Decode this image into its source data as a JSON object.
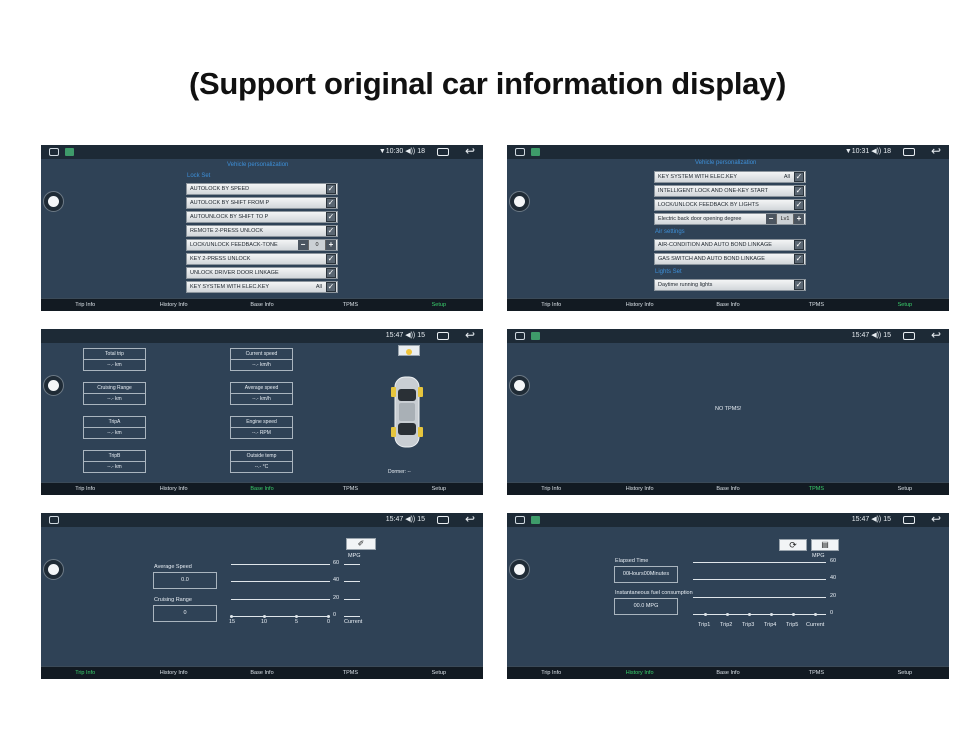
{
  "heading": "(Support original car information display)",
  "nav": [
    "Trip Info",
    "History Info",
    "Base Info",
    "TPMS",
    "Setup"
  ],
  "colors": {
    "panel_bg": "#2f4256",
    "status_bar": "#1d2a36",
    "nav_bg": "#121a22",
    "nav_active": "#3ad16d",
    "section_blue": "#3d8fd8"
  },
  "panels": {
    "p1": {
      "status": "▼10:30 ◀)) 18",
      "title": "Vehicle personalization",
      "section": "Lock Set",
      "rows": [
        {
          "label": "AUTOLOCK BY SPEED",
          "control": "check"
        },
        {
          "label": "AUTOLOCK BY SHIFT FROM P",
          "control": "check"
        },
        {
          "label": "AUTOUNLOCK BY SHIFT TO P",
          "control": "check"
        },
        {
          "label": "REMOTE 2-PRESS UNLOCK",
          "control": "check"
        },
        {
          "label": "LOCK/UNLOCK FEEDBACK-TONE",
          "control": "stepper",
          "value": "0"
        },
        {
          "label": "KEY 2-PRESS UNLOCK",
          "control": "check"
        },
        {
          "label": "UNLOCK DRIVER DOOR LINKAGE",
          "control": "check"
        },
        {
          "label": "KEY SYSTEM WITH ELEC.KEY",
          "control": "check",
          "value": "All"
        }
      ],
      "active_tab": "Setup"
    },
    "p2": {
      "status": "▼10:31 ◀)) 18",
      "title": "Vehicle personalization",
      "rows1": [
        {
          "label": "KEY SYSTEM WITH ELEC.KEY",
          "value": "All"
        },
        {
          "label": "INTELLIGENT LOCK AND ONE-KEY START"
        },
        {
          "label": "LOCK/UNLOCK FEEDBACK BY LIGHTS"
        },
        {
          "label": "Electric back door opening degree",
          "stepper": "Lv1"
        }
      ],
      "section_air": "Air settings",
      "rows2": [
        {
          "label": "AIR-CONDITION AND AUTO BOND LINKAGE"
        },
        {
          "label": "GAS SWITCH AND AUTO BOND LINKAGE"
        }
      ],
      "section_lights": "Lights Set",
      "rows3": [
        {
          "label": "Daytime running lights"
        }
      ],
      "active_tab": "Setup"
    },
    "p3": {
      "status": "15:47 ◀)) 15",
      "left": [
        {
          "label": "Total trip",
          "value": "--.- km"
        },
        {
          "label": "Cruising Range",
          "value": "--.- km"
        },
        {
          "label": "TripA",
          "value": "--.- km"
        },
        {
          "label": "TripB",
          "value": "--.- km"
        }
      ],
      "right": [
        {
          "label": "Current speed",
          "value": "--.- km/h"
        },
        {
          "label": "Average speed",
          "value": "--.- km/h"
        },
        {
          "label": "Engine speed",
          "value": "--.- RPM"
        },
        {
          "label": "Outside temp",
          "value": "--.- °C"
        }
      ],
      "dormer": "Dormer: --",
      "active_tab": "Base Info"
    },
    "p4": {
      "status": "15:47 ◀)) 15",
      "message": "NO TPMS!",
      "active_tab": "TPMS"
    },
    "p5": {
      "status": "15:47 ◀)) 15",
      "avg_speed_label": "Average Speed",
      "avg_speed_value": "0.0",
      "cruising_label": "Cruising Range",
      "cruising_value": "0",
      "unit": "MPG",
      "y_ticks": [
        "60",
        "40",
        "20",
        "0"
      ],
      "x_ticks": [
        "15",
        "10",
        "5",
        "0",
        "Current"
      ],
      "active_tab": "Trip Info"
    },
    "p6": {
      "status": "15:47 ◀)) 15",
      "elapsed_label": "Elapsed Time",
      "elapsed_value": "00Hours00Minutes",
      "fuel_label": "Instantaneous fuel consumption",
      "fuel_value": "00.0 MPG",
      "unit": "MPG",
      "y_ticks": [
        "60",
        "40",
        "20",
        "0"
      ],
      "x_ticks": [
        "Trip1",
        "Trip2",
        "Trip3",
        "Trip4",
        "Trip5",
        "Current"
      ],
      "active_tab": "History Info"
    }
  }
}
